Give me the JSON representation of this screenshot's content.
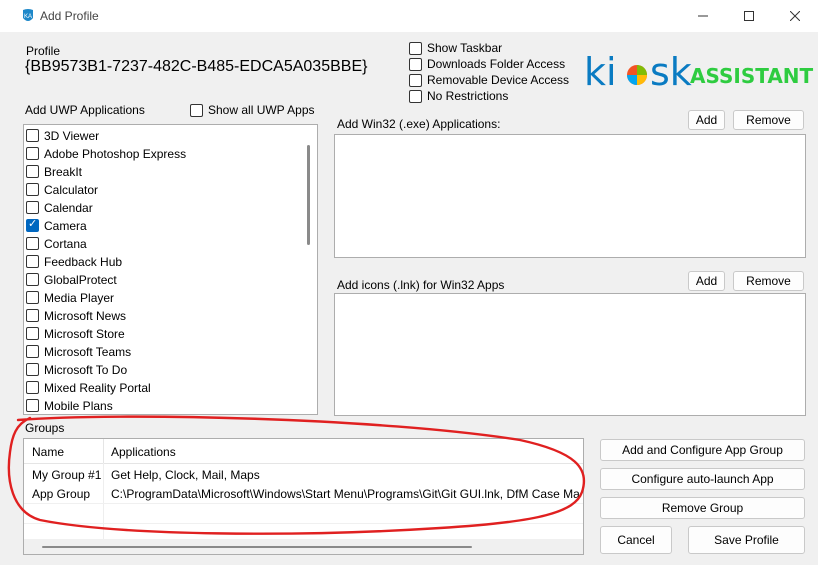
{
  "window": {
    "title": "Add Profile",
    "min_icon": "minimize-icon",
    "max_icon": "maximize-icon",
    "close_icon": "close-icon"
  },
  "profile": {
    "label": "Profile",
    "guid": "{BB9573B1-7237-482C-B485-EDCA5A035BBE}"
  },
  "options": [
    {
      "label": "Show Taskbar",
      "checked": false
    },
    {
      "label": "Downloads Folder Access",
      "checked": false
    },
    {
      "label": "Removable Device Access",
      "checked": false
    },
    {
      "label": "No Restrictions",
      "checked": false
    }
  ],
  "logo": {
    "kiosk": "ki",
    "kiosk2": "sk",
    "assistant": "ASSISTANT",
    "colors": {
      "k": "#0078d4",
      "assistant": "#2ecc40"
    }
  },
  "uwp": {
    "label": "Add UWP Applications",
    "show_all_label": "Show all UWP Apps",
    "items": [
      {
        "label": "3D Viewer",
        "checked": false
      },
      {
        "label": "Adobe Photoshop Express",
        "checked": false
      },
      {
        "label": "BreakIt",
        "checked": false
      },
      {
        "label": "Calculator",
        "checked": false
      },
      {
        "label": "Calendar",
        "checked": false
      },
      {
        "label": "Camera",
        "checked": true
      },
      {
        "label": "Cortana",
        "checked": false
      },
      {
        "label": "Feedback Hub",
        "checked": false
      },
      {
        "label": "GlobalProtect",
        "checked": false
      },
      {
        "label": "Media Player",
        "checked": false
      },
      {
        "label": "Microsoft News",
        "checked": false
      },
      {
        "label": "Microsoft Store",
        "checked": false
      },
      {
        "label": "Microsoft Teams",
        "checked": false
      },
      {
        "label": "Microsoft To Do",
        "checked": false
      },
      {
        "label": "Mixed Reality Portal",
        "checked": false
      },
      {
        "label": "Mobile Plans",
        "checked": false
      }
    ]
  },
  "win32": {
    "label": "Add Win32 (.exe) Applications:",
    "add_label": "Add",
    "remove_label": "Remove"
  },
  "icons": {
    "label": "Add icons (.lnk) for Win32 Apps",
    "add_label": "Add",
    "remove_label": "Remove"
  },
  "groups": {
    "label": "Groups",
    "columns": [
      "Name",
      "Applications"
    ],
    "rows": [
      {
        "name": "My Group #1",
        "apps": "Get Help, Clock, Mail, Maps"
      },
      {
        "name": "App Group",
        "apps": "C:\\ProgramData\\Microsoft\\Windows\\Start Menu\\Programs\\Git\\Git GUI.lnk, DfM Case Ma"
      }
    ]
  },
  "actions": {
    "add_configure": "Add and Configure App Group",
    "configure_autolaunch": "Configure auto-launch App",
    "remove_group": "Remove Group",
    "cancel": "Cancel",
    "save": "Save Profile"
  },
  "annotation": {
    "color": "#e02020"
  }
}
